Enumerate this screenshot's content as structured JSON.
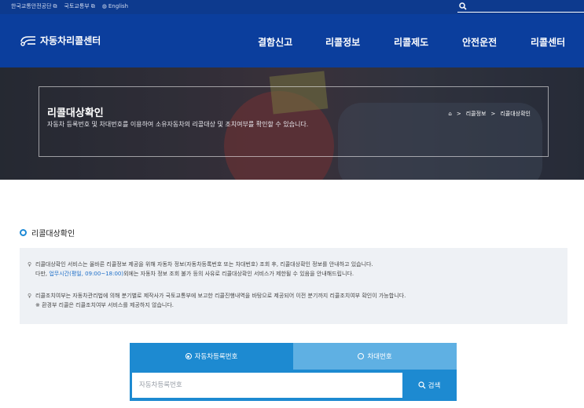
{
  "topbar": {
    "links": [
      {
        "label": "한국교통안전공단",
        "icon": "external-link-icon"
      },
      {
        "label": "국토교통부",
        "icon": "external-link-icon"
      },
      {
        "label": "English",
        "icon": "globe-icon"
      }
    ],
    "search": {
      "placeholder": "",
      "value": ""
    }
  },
  "nav": {
    "logo_text": "자동차리콜센터",
    "menu": [
      "결함신고",
      "리콜정보",
      "리콜제도",
      "안전운전",
      "리콜센터"
    ]
  },
  "hero": {
    "title": "리콜대상확인",
    "subtitle": "자동차 등록번호 및 차대번호를 이용하여 소유자동차의 리콜대상 및 조치여부를 확인할 수 있습니다.",
    "breadcrumb": [
      "리콜정보",
      "리콜대상확인"
    ],
    "breadcrumb_sep": ">"
  },
  "section": {
    "title": "리콜대상확인"
  },
  "notice": {
    "line1": "리콜대상확인 서비스는 올바른 리콜정보 제공을 위해 자동차 정보(자동차등록번호 또는 차대번호) 조회 후, 리콜대상확인 정보를 안내하고 있습니다.",
    "line2_pre": "다만, ",
    "line2_link": "업무시간(평일, 09:00~18:00)",
    "line2_post": "외에는 자동차 정보 조회 불가 등의 사유로 리콜대상확인 서비스가 제한될 수 있음을 안내해드립니다.",
    "line3": "리콜조치여부는 자동차관리법에 의해 분기별로 제작사가 국토교통부에 보고한 리콜진행내역을 바탕으로 제공되어 이전 분기까지 리콜조치여부 확인이 가능합니다.",
    "line4": "※ 환경부 리콜은 리콜조치여부 서비스를 제공하지 않습니다."
  },
  "form": {
    "tab_active": "자동차등록번호",
    "tab_inactive": "차대번호",
    "input_placeholder": "자동차등록번호",
    "search_label": "검색"
  },
  "colors": {
    "topbar": "#0d3a8e",
    "nav": "#0b3e9d",
    "accent": "#1d8ad1",
    "tab_inactive": "#5fb0e3",
    "notice_bg": "#eef1f5",
    "link_blue": "#1e6fc8",
    "warn_orange": "#f07a3a"
  }
}
